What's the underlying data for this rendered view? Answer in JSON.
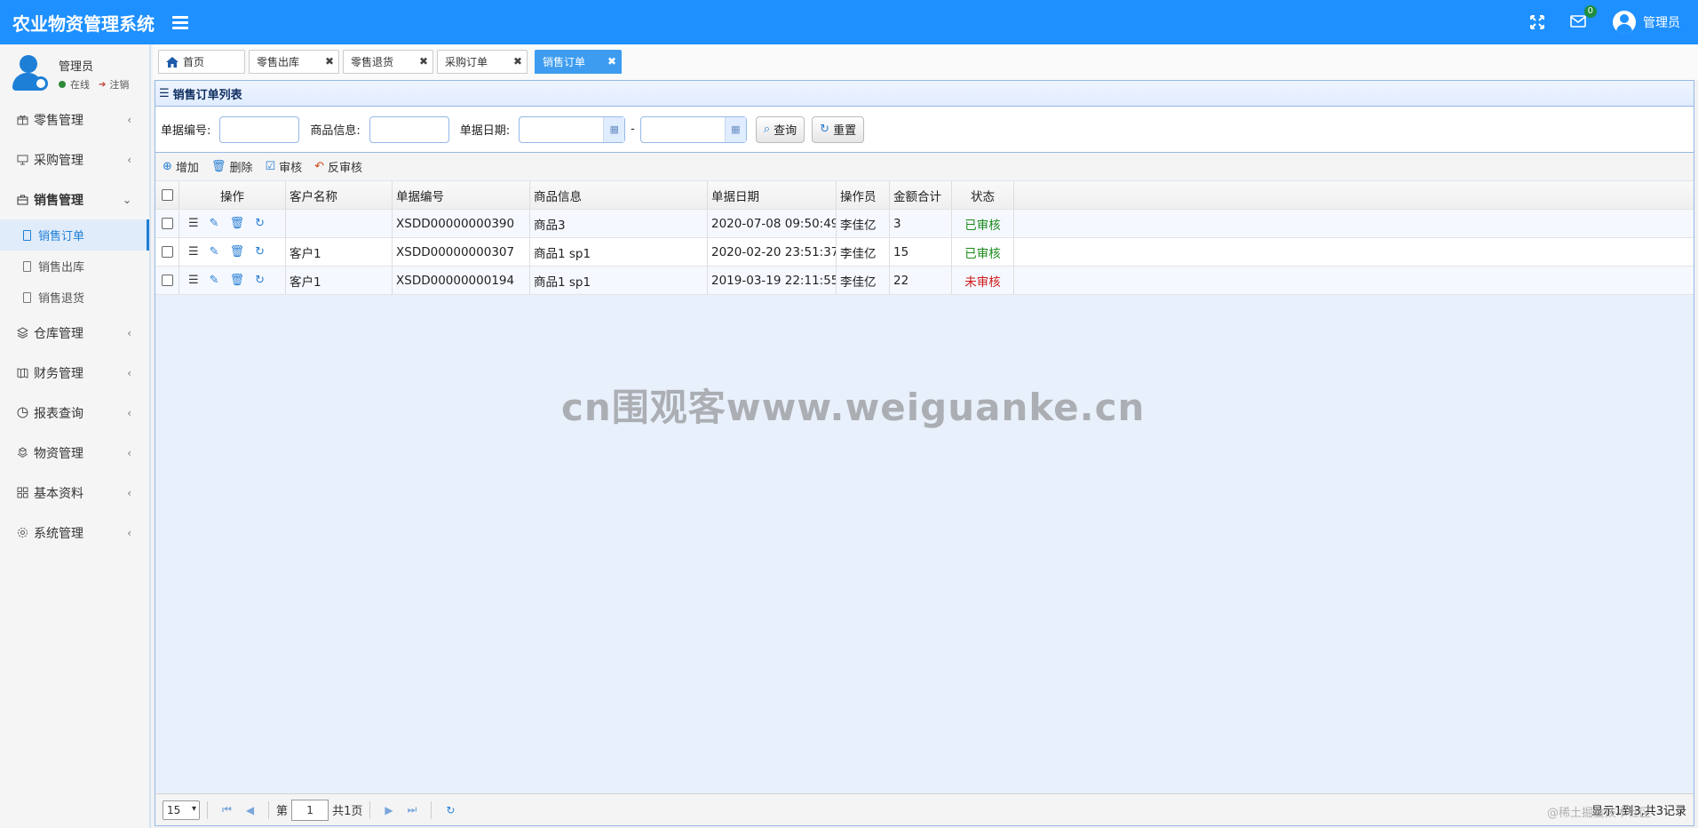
{
  "app": {
    "title": "农业物资管理系统",
    "user": "管理员",
    "mail_count": "0"
  },
  "profile": {
    "name": "管理员",
    "status": "在线",
    "logout": "注销"
  },
  "sidebar": {
    "items": [
      {
        "label": "零售管理",
        "icon": "gift-icon"
      },
      {
        "label": "采购管理",
        "icon": "monitor-icon"
      },
      {
        "label": "销售管理",
        "icon": "briefcase-icon"
      },
      {
        "label": "仓库管理",
        "icon": "layers-icon"
      },
      {
        "label": "财务管理",
        "icon": "map-icon"
      },
      {
        "label": "报表查询",
        "icon": "pie-icon"
      },
      {
        "label": "物资管理",
        "icon": "box-icon"
      },
      {
        "label": "基本资料",
        "icon": "grid-icon"
      },
      {
        "label": "系统管理",
        "icon": "gear-icon"
      }
    ],
    "sales_sub": [
      "销售订单",
      "销售出库",
      "销售退货"
    ]
  },
  "tabs": [
    "首页",
    "零售出库",
    "零售退货",
    "采购订单",
    "销售订单"
  ],
  "panel": {
    "title": "销售订单列表"
  },
  "search": {
    "doc_no_label": "单据编号:",
    "goods_label": "商品信息:",
    "date_label": "单据日期:",
    "dash": "-",
    "query_btn": "查询",
    "reset_btn": "重置"
  },
  "toolbar": {
    "add": "增加",
    "delete": "删除",
    "audit": "审核",
    "unaudit": "反审核"
  },
  "grid": {
    "headers": [
      "操作",
      "客户名称",
      "单据编号",
      "商品信息",
      "单据日期",
      "操作员",
      "金额合计",
      "状态"
    ],
    "rows": [
      {
        "customer": "",
        "doc_no": "XSDD00000000390",
        "goods": "商品3",
        "date": "2020-07-08 09:50:49",
        "operator": "李佳亿",
        "amount": "3",
        "status": "已审核",
        "audited": true
      },
      {
        "customer": "客户1",
        "doc_no": "XSDD00000000307",
        "goods": "商品1 sp1",
        "date": "2020-02-20 23:51:37",
        "operator": "李佳亿",
        "amount": "15",
        "status": "已审核",
        "audited": true
      },
      {
        "customer": "客户1",
        "doc_no": "XSDD00000000194",
        "goods": "商品1 sp1",
        "date": "2019-03-19 22:11:55",
        "operator": "李佳亿",
        "amount": "22",
        "status": "未审核",
        "audited": false
      }
    ]
  },
  "pager": {
    "page_size": "15",
    "page_prefix": "第",
    "page": "1",
    "page_total": "共1页",
    "info": "显示1到3,共3记录"
  },
  "watermark": "cn围观客www.weiguanke.cn",
  "credit": "@稀土掘金技术社区"
}
